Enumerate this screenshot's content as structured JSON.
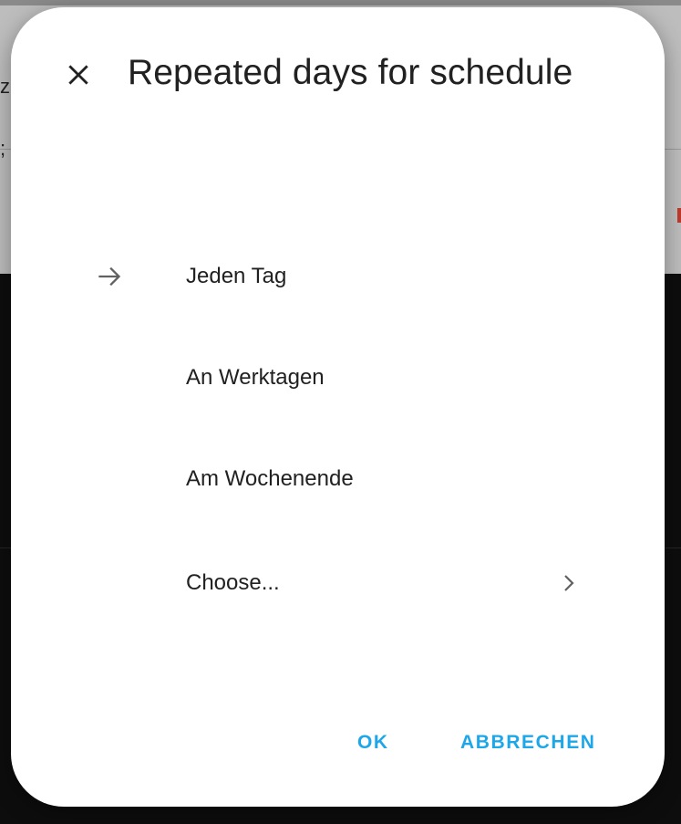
{
  "background": {
    "fragments": [
      "z",
      ";"
    ]
  },
  "dialog": {
    "title": "Repeated days for schedule",
    "close_icon": "close-icon",
    "options": [
      {
        "label": "Jeden Tag",
        "icon": "arrow-right-icon",
        "selected": true
      },
      {
        "label": "An Werktagen"
      },
      {
        "label": "Am Wochenende"
      },
      {
        "label": "Choose...",
        "trailing_icon": "chevron-right-icon"
      }
    ],
    "actions": {
      "ok_label": "OK",
      "cancel_label": "ABBRECHEN"
    }
  },
  "colors": {
    "accent": "#1ea7e8",
    "text": "#212121",
    "icon": "#616161"
  }
}
